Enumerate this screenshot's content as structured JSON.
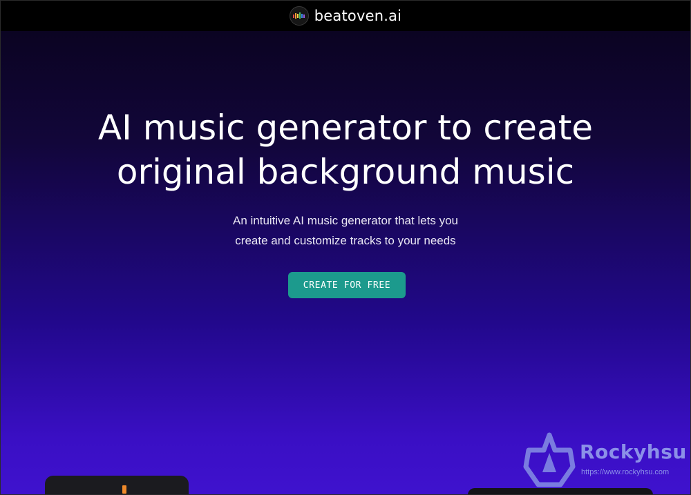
{
  "header": {
    "brand_name": "beatoven.ai",
    "logo_icon": "equalizer-bars-icon",
    "logo_colors": [
      "#e64a4a",
      "#f0a030",
      "#f3d34a",
      "#4ac16a",
      "#3c8ee8",
      "#9b5be0"
    ]
  },
  "hero": {
    "headline_line1": "AI music generator to create",
    "headline_line2": "original background music",
    "subhead_line1": "An intuitive AI music generator that lets you",
    "subhead_line2": "create and customize tracks to your needs",
    "cta_label": "CREATE FOR FREE"
  },
  "watermark": {
    "name": "Rockyhsu",
    "url": "https://www.rockyhsu.com"
  },
  "colors": {
    "cta": "#1c9a8d",
    "background_top": "#0b0422",
    "background_bottom": "#3f12ce",
    "topbar": "#000000"
  }
}
